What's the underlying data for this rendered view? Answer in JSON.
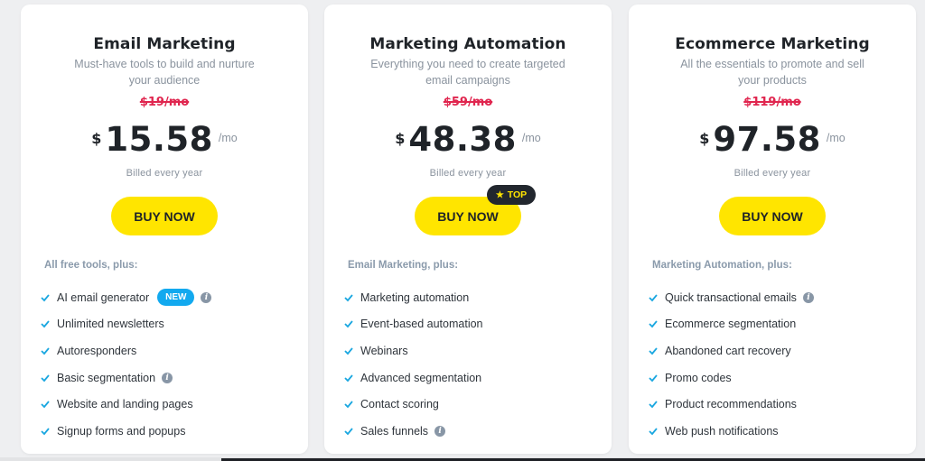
{
  "plans": [
    {
      "title": "Email Marketing",
      "subtitle": "Must-have tools to build and nurture your audience",
      "old_price": "$19/mo",
      "currency": "$",
      "price": "15.58",
      "per": "/mo",
      "billed": "Billed every year",
      "button": "BUY NOW",
      "features_heading": "All free tools, plus:",
      "features": [
        {
          "label": "AI email generator",
          "badge": "NEW",
          "info": true
        },
        {
          "label": "Unlimited newsletters",
          "info": false
        },
        {
          "label": "Autoresponders",
          "info": false
        },
        {
          "label": "Basic segmentation",
          "info": true
        },
        {
          "label": "Website and landing pages",
          "info": false
        },
        {
          "label": "Signup forms and popups",
          "info": false
        }
      ]
    },
    {
      "title": "Marketing Automation",
      "subtitle": "Everything you need to create targeted email campaigns",
      "old_price": "$59/mo",
      "currency": "$",
      "price": "48.38",
      "per": "/mo",
      "billed": "Billed every year",
      "button": "BUY NOW",
      "top_badge": "TOP",
      "features_heading": "Email Marketing, plus:",
      "features": [
        {
          "label": "Marketing automation",
          "info": false
        },
        {
          "label": "Event-based automation",
          "info": false
        },
        {
          "label": "Webinars",
          "info": false
        },
        {
          "label": "Advanced segmentation",
          "info": false
        },
        {
          "label": "Contact scoring",
          "info": false
        },
        {
          "label": "Sales funnels",
          "info": true
        }
      ]
    },
    {
      "title": "Ecommerce Marketing",
      "subtitle": "All the essentials to promote and sell your products",
      "old_price": "$119/mo",
      "currency": "$",
      "price": "97.58",
      "per": "/mo",
      "billed": "Billed every year",
      "button": "BUY NOW",
      "features_heading": "Marketing Automation, plus:",
      "features": [
        {
          "label": "Quick transactional emails",
          "info": true
        },
        {
          "label": "Ecommerce segmentation",
          "info": false
        },
        {
          "label": "Abandoned cart recovery",
          "info": false
        },
        {
          "label": "Promo codes",
          "info": false
        },
        {
          "label": "Product recommendations",
          "info": false
        },
        {
          "label": "Web push notifications",
          "info": false
        }
      ]
    }
  ],
  "icons": {
    "check": "check-icon",
    "info": "info-icon",
    "info_glyph": "i",
    "star": "★"
  },
  "colors": {
    "accent_yellow": "#ffe500",
    "old_price_red": "#e0264f",
    "check_blue": "#1aa7e0",
    "new_badge_blue": "#12a9ef",
    "badge_dark": "#22272e"
  }
}
